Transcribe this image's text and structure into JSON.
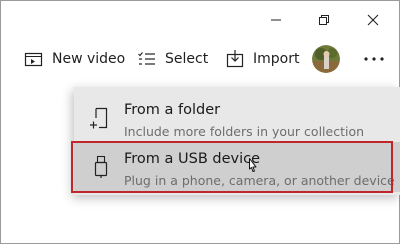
{
  "window_controls": {
    "minimize": "minimize",
    "maximize": "restore",
    "close": "close"
  },
  "toolbar": {
    "new_video_label": "New video",
    "select_label": "Select",
    "import_label": "Import",
    "more_icon": "more-icon"
  },
  "import_menu": {
    "items": [
      {
        "title": "From a folder",
        "subtitle": "Include more folders in your collection",
        "icon": "folder-add-icon"
      },
      {
        "title": "From a USB device",
        "subtitle": "Plug in a phone, camera, or another device",
        "icon": "usb-icon",
        "hovered": true
      }
    ]
  },
  "colors": {
    "highlight_border": "#c0262c",
    "flyout_bg": "#e8e8e8",
    "hover_bg": "#cfcfcf"
  }
}
